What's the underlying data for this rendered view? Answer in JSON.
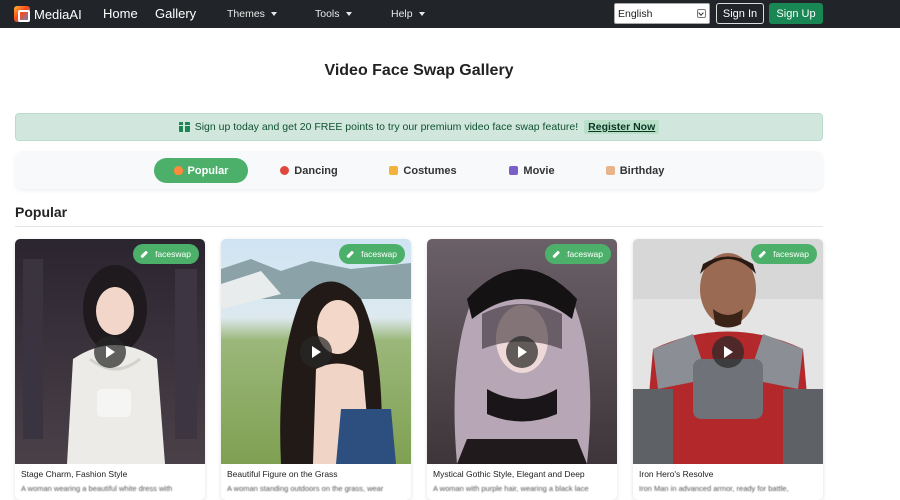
{
  "navbar": {
    "brand": "MediaAI",
    "links": {
      "home": "Home",
      "gallery": "Gallery"
    },
    "dropdowns": {
      "themes": "Themes",
      "tools": "Tools",
      "help": "Help"
    },
    "language": "English",
    "sign_in": "Sign In",
    "sign_up": "Sign Up"
  },
  "page": {
    "title": "Video Face Swap Gallery"
  },
  "promo": {
    "text": "Sign up today and get 20 FREE points to try our premium video face swap feature!",
    "link": "Register Now"
  },
  "tabs": [
    {
      "label": "Popular",
      "icon": "fire-icon",
      "active": true
    },
    {
      "label": "Dancing",
      "icon": "dancer-icon",
      "active": false
    },
    {
      "label": "Costumes",
      "icon": "crown-icon",
      "active": false
    },
    {
      "label": "Movie",
      "icon": "film-icon",
      "active": false
    },
    {
      "label": "Birthday",
      "icon": "cake-icon",
      "active": false
    }
  ],
  "section": {
    "title": "Popular"
  },
  "cards": [
    {
      "badge": "faceswap",
      "title": "Stage Charm, Fashion Style",
      "desc": "A woman wearing a beautiful white dress with"
    },
    {
      "badge": "faceswap",
      "title": "Beautiful Figure on the Grass",
      "desc": "A woman standing outdoors on the grass, wear"
    },
    {
      "badge": "faceswap",
      "title": "Mystical Gothic Style, Elegant and Deep",
      "desc": "A woman with purple hair, wearing a black lace"
    },
    {
      "badge": "faceswap",
      "title": "Iron Hero's Resolve",
      "desc": "Iron Man in advanced armor, ready for battle,"
    }
  ],
  "colors": {
    "navbar": "#212529",
    "accent_green": "#4cb06a",
    "signup": "#198754",
    "promo_bg": "#d1e7dd"
  }
}
